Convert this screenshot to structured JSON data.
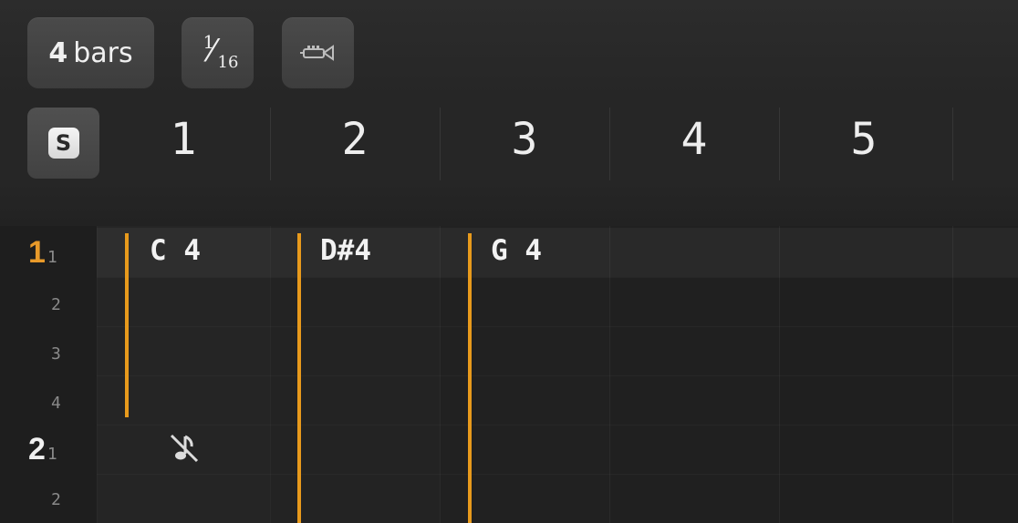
{
  "toolbar": {
    "length_number": "4",
    "length_unit": "bars",
    "step": {
      "numerator": "1",
      "denominator": "16"
    },
    "instrument_icon": "horn-icon"
  },
  "header": {
    "s_label": "S",
    "columns": [
      "1",
      "2",
      "3",
      "4",
      "5"
    ]
  },
  "rows": {
    "bar1": {
      "bar": "1",
      "beat": "1"
    },
    "beats_bar1": [
      "2",
      "3",
      "4"
    ],
    "bar2": {
      "bar": "2",
      "beat": "1"
    },
    "beats_bar2": [
      "2"
    ]
  },
  "notes": [
    {
      "label": "C 4"
    },
    {
      "label": "D#4"
    },
    {
      "label": "G 4"
    }
  ],
  "mute_icon": "muted-note-icon",
  "colors": {
    "accent": "#e89a1c",
    "background": "#1f1f1f"
  }
}
